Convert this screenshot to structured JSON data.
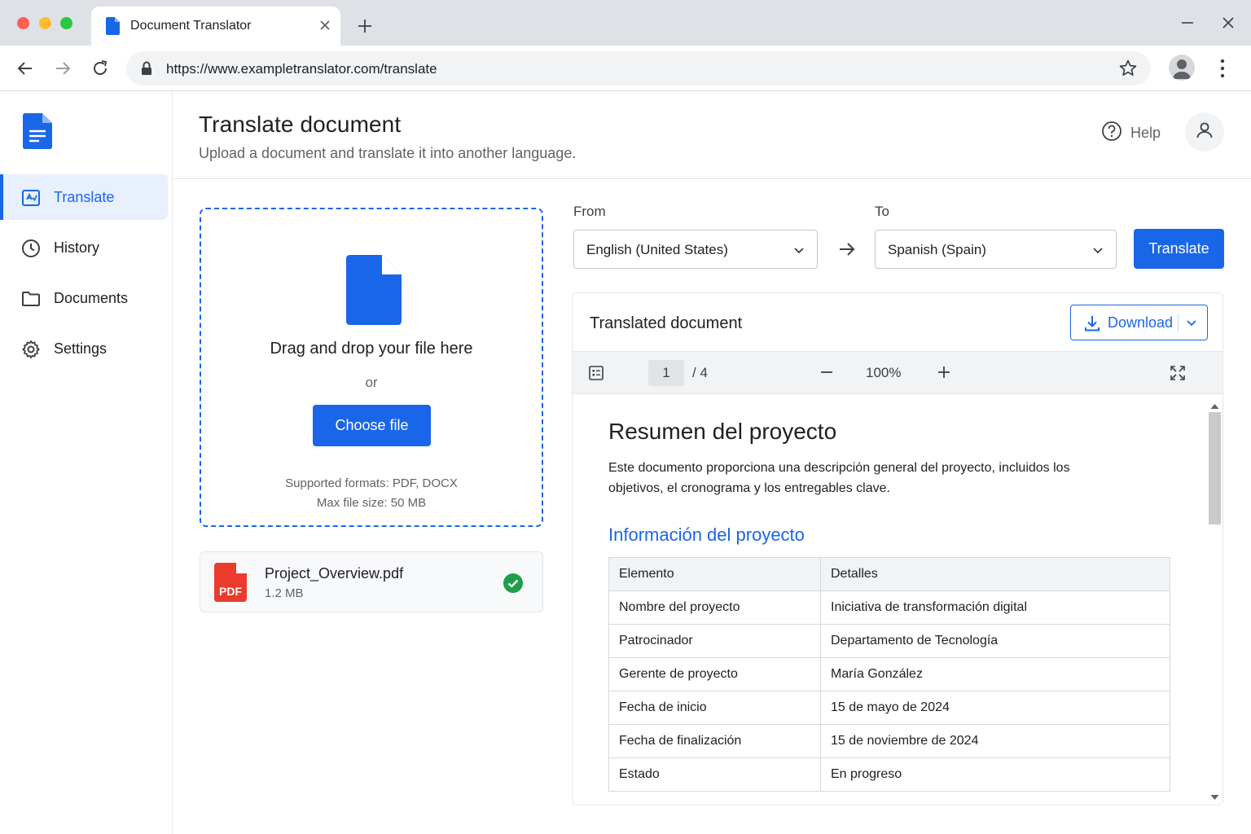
{
  "browser": {
    "tab_title": "Document Translator",
    "url": "https://www.exampletranslator.com/translate"
  },
  "sidebar": {
    "items": [
      {
        "label": "Translate",
        "icon": "translate-icon",
        "active": true
      },
      {
        "label": "History",
        "icon": "clock-icon",
        "active": false
      },
      {
        "label": "Documents",
        "icon": "folder-icon",
        "active": false
      },
      {
        "label": "Settings",
        "icon": "gear-icon",
        "active": false
      }
    ]
  },
  "header": {
    "title": "Translate document",
    "subtitle": "Upload a document and translate it into another language.",
    "help_label": "Help"
  },
  "upload": {
    "drop_title": "Drag and drop your file here",
    "or_text": "or",
    "choose_label": "Choose file",
    "formats": "Supported formats: PDF, DOCX",
    "max_size": "Max file size: 50 MB"
  },
  "file": {
    "badge": "PDF",
    "name": "Project_Overview.pdf",
    "size": "1.2 MB"
  },
  "languages": {
    "from_label": "From",
    "from_value": "English (United States)",
    "to_label": "To",
    "to_value": "Spanish (Spain)",
    "translate_label": "Translate"
  },
  "preview": {
    "title": "Translated document",
    "download_label": "Download",
    "page_current": "1",
    "page_total": "/ 4",
    "zoom": "100%"
  },
  "document": {
    "heading": "Resumen del proyecto",
    "paragraph": "Este documento proporciona una descripción general del proyecto, incluidos los objetivos, el cronograma y los entregables clave.",
    "section_heading": "Información del proyecto",
    "table_headers": [
      "Elemento",
      "Detalles"
    ],
    "table_rows": [
      [
        "Nombre del proyecto",
        "Iniciativa de transformación digital"
      ],
      [
        "Patrocinador",
        "Departamento de Tecnología"
      ],
      [
        "Gerente de proyecto",
        "María González"
      ],
      [
        "Fecha de inicio",
        "15 de mayo de 2024"
      ],
      [
        "Fecha de finalización",
        "15 de noviembre de 2024"
      ],
      [
        "Estado",
        "En progreso"
      ]
    ]
  },
  "colors": {
    "accent": "#1a66e8",
    "pdf_red": "#ea3b2e",
    "success_green": "#1e9e4a"
  }
}
